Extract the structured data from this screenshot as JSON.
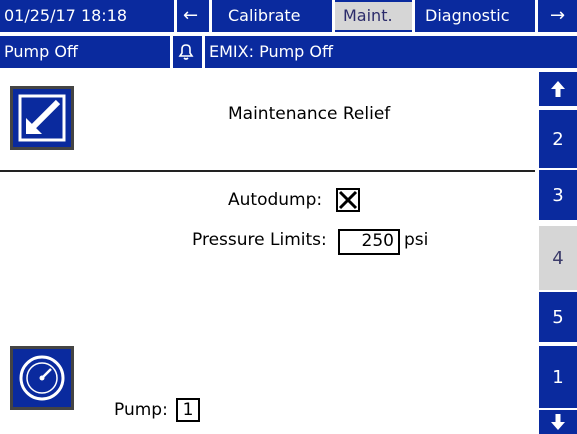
{
  "header": {
    "datetime": "01/25/17 18:18",
    "back_arrow": "←",
    "tabs": [
      {
        "label": "Calibrate",
        "active": false
      },
      {
        "label": "Maint.",
        "active": true
      },
      {
        "label": "Diagnostic",
        "active": false
      }
    ],
    "forward_arrow": "→"
  },
  "status": {
    "pump_state": "Pump Off",
    "alarm_icon": "bell-icon",
    "message": "EMIX: Pump Off"
  },
  "main": {
    "title": "Maintenance Relief",
    "autodump_label": "Autodump:",
    "autodump_checked": true,
    "pressure_label": "Pressure Limits:",
    "pressure_value": "250",
    "pressure_unit": "psi",
    "pump_label": "Pump:",
    "pump_value": "1"
  },
  "side_nav": {
    "up_icon": "up-arrow-icon",
    "items": [
      {
        "label": "2",
        "active": false
      },
      {
        "label": "3",
        "active": false
      },
      {
        "label": "4",
        "active": true
      },
      {
        "label": "5",
        "active": false
      },
      {
        "label": "1",
        "active": false
      }
    ],
    "down_icon": "down-arrow-icon"
  },
  "colors": {
    "bar_blue": "#0a2a9e",
    "active_tab": "#d6d6d6"
  }
}
